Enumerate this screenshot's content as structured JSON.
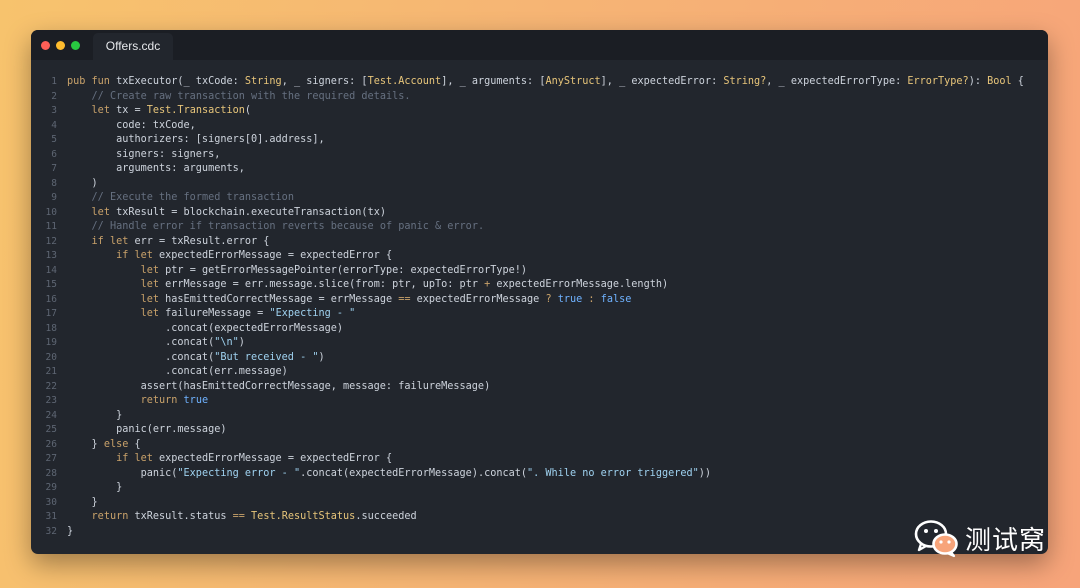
{
  "window": {
    "tab_title": "Offers.cdc"
  },
  "editor": {
    "line_numbers": [
      "1",
      "2",
      "3",
      "4",
      "5",
      "6",
      "7",
      "8",
      "9",
      "10",
      "11",
      "12",
      "13",
      "14",
      "15",
      "16",
      "17",
      "18",
      "19",
      "20",
      "21",
      "22",
      "23",
      "24",
      "25",
      "26",
      "27",
      "28",
      "29",
      "30",
      "31",
      "32"
    ],
    "lines": [
      [
        [
          "k",
          "pub fun "
        ],
        [
          "p",
          "txExecutor(_ txCode: "
        ],
        [
          "t",
          "String"
        ],
        [
          "p",
          ", _ signers: ["
        ],
        [
          "t",
          "Test.Account"
        ],
        [
          "p",
          "], _ arguments: ["
        ],
        [
          "t",
          "AnyStruct"
        ],
        [
          "p",
          "], _ expectedError: "
        ],
        [
          "t",
          "String?"
        ],
        [
          "p",
          ", _ expectedErrorType: "
        ],
        [
          "t",
          "ErrorType?"
        ],
        [
          "p",
          "): "
        ],
        [
          "t",
          "Bool"
        ],
        [
          "p",
          " {"
        ]
      ],
      [
        [
          "p",
          "    "
        ],
        [
          "c",
          "// Create raw transaction with the required details."
        ]
      ],
      [
        [
          "p",
          "    "
        ],
        [
          "k",
          "let "
        ],
        [
          "p",
          "tx = "
        ],
        [
          "t",
          "Test.Transaction"
        ],
        [
          "p",
          "("
        ]
      ],
      [
        [
          "p",
          "        code: txCode,"
        ]
      ],
      [
        [
          "p",
          "        authorizers: [signers[0].address],"
        ]
      ],
      [
        [
          "p",
          "        signers: signers,"
        ]
      ],
      [
        [
          "p",
          "        arguments: arguments,"
        ]
      ],
      [
        [
          "p",
          "    )"
        ]
      ],
      [
        [
          "p",
          "    "
        ],
        [
          "c",
          "// Execute the formed transaction"
        ]
      ],
      [
        [
          "p",
          "    "
        ],
        [
          "k",
          "let "
        ],
        [
          "p",
          "txResult = blockchain.executeTransaction(tx)"
        ]
      ],
      [
        [
          "p",
          "    "
        ],
        [
          "c",
          "// Handle error if transaction reverts because of panic & error."
        ]
      ],
      [
        [
          "p",
          "    "
        ],
        [
          "k",
          "if let "
        ],
        [
          "p",
          "err = txResult.error {"
        ]
      ],
      [
        [
          "p",
          "        "
        ],
        [
          "k",
          "if let "
        ],
        [
          "p",
          "expectedErrorMessage = expectedError {"
        ]
      ],
      [
        [
          "p",
          "            "
        ],
        [
          "k",
          "let "
        ],
        [
          "p",
          "ptr = getErrorMessagePointer(errorType: expectedErrorType!)"
        ]
      ],
      [
        [
          "p",
          "            "
        ],
        [
          "k",
          "let "
        ],
        [
          "p",
          "errMessage = err.message.slice(from: ptr, upTo: ptr "
        ],
        [
          "k",
          "+"
        ],
        [
          "p",
          " expectedErrorMessage.length)"
        ]
      ],
      [
        [
          "p",
          "            "
        ],
        [
          "k",
          "let "
        ],
        [
          "p",
          "hasEmittedCorrectMessage = errMessage "
        ],
        [
          "k",
          "=="
        ],
        [
          "p",
          " expectedErrorMessage "
        ],
        [
          "k",
          "?"
        ],
        [
          "p",
          " "
        ],
        [
          "b",
          "true"
        ],
        [
          "p",
          " "
        ],
        [
          "k",
          ":"
        ],
        [
          "p",
          " "
        ],
        [
          "b",
          "false"
        ]
      ],
      [
        [
          "p",
          "            "
        ],
        [
          "k",
          "let "
        ],
        [
          "p",
          "failureMessage = "
        ],
        [
          "s",
          "\"Expecting - \""
        ]
      ],
      [
        [
          "p",
          "                .concat(expectedErrorMessage)"
        ]
      ],
      [
        [
          "p",
          "                .concat("
        ],
        [
          "s",
          "\"\\n\""
        ],
        [
          "p",
          ")"
        ]
      ],
      [
        [
          "p",
          "                .concat("
        ],
        [
          "s",
          "\"But received - \""
        ],
        [
          "p",
          ")"
        ]
      ],
      [
        [
          "p",
          "                .concat(err.message)"
        ]
      ],
      [
        [
          "p",
          "            assert(hasEmittedCorrectMessage, message: failureMessage)"
        ]
      ],
      [
        [
          "p",
          "            "
        ],
        [
          "k",
          "return "
        ],
        [
          "b",
          "true"
        ]
      ],
      [
        [
          "p",
          "        }"
        ]
      ],
      [
        [
          "p",
          "        panic(err.message)"
        ]
      ],
      [
        [
          "p",
          "    } "
        ],
        [
          "k",
          "else"
        ],
        [
          "p",
          " {"
        ]
      ],
      [
        [
          "p",
          "        "
        ],
        [
          "k",
          "if let "
        ],
        [
          "p",
          "expectedErrorMessage = expectedError {"
        ]
      ],
      [
        [
          "p",
          "            panic("
        ],
        [
          "s",
          "\"Expecting error - \""
        ],
        [
          "p",
          ".concat(expectedErrorMessage).concat("
        ],
        [
          "s",
          "\". While no error triggered\""
        ],
        [
          "p",
          "))"
        ]
      ],
      [
        [
          "p",
          "        }"
        ]
      ],
      [
        [
          "p",
          "    }"
        ]
      ],
      [
        [
          "p",
          "    "
        ],
        [
          "k",
          "return "
        ],
        [
          "p",
          "txResult.status "
        ],
        [
          "k",
          "=="
        ],
        [
          "p",
          " "
        ],
        [
          "t",
          "Test.ResultStatus"
        ],
        [
          "p",
          ".succeeded"
        ]
      ],
      [
        [
          "p",
          "}"
        ]
      ]
    ]
  },
  "watermark": {
    "text": "测试窝",
    "icon": "wechat-icon"
  },
  "colors": {
    "background_left": "#f7c36d",
    "background_right": "#f7a47a",
    "editor_bg": "#22262d",
    "keyword": "#c9a26a",
    "type": "#e7c57a",
    "comment": "#667080",
    "string": "#9fd2f0",
    "boolean": "#6fb2ff"
  }
}
